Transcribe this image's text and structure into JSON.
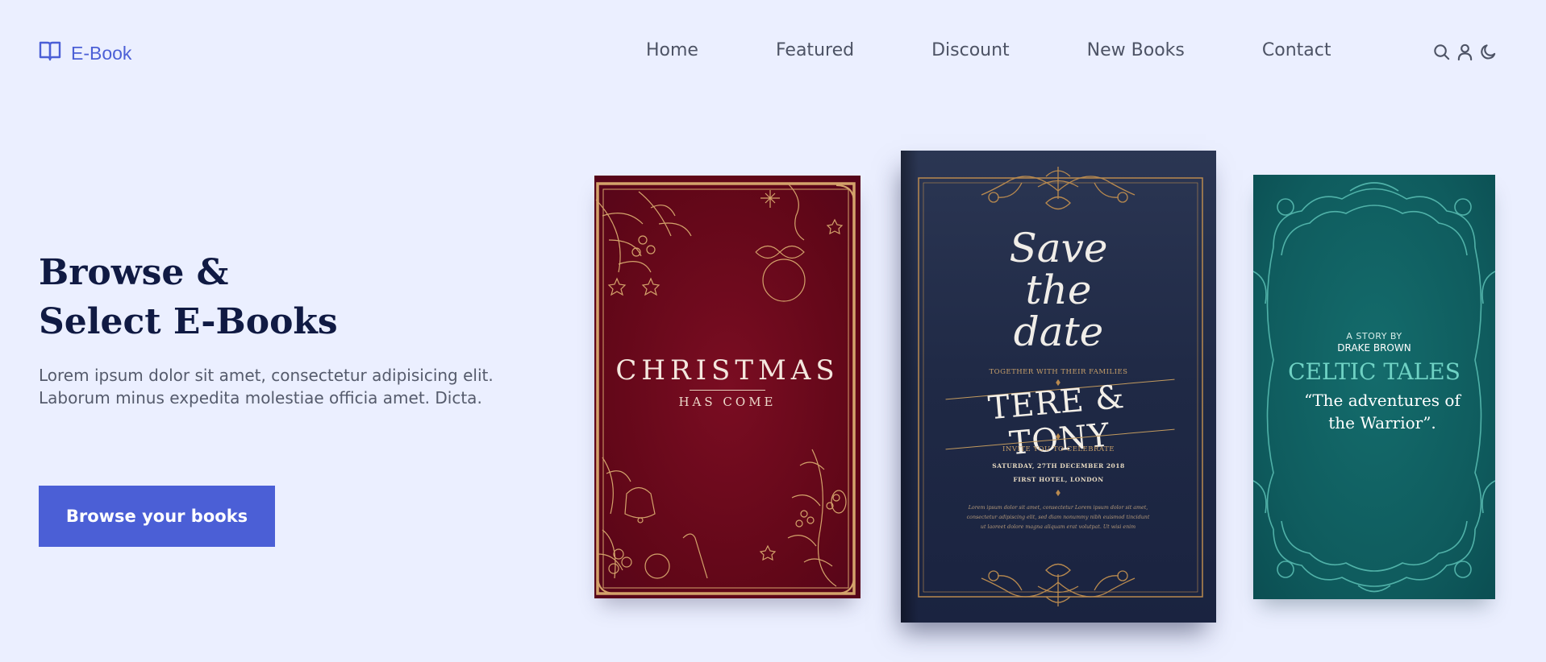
{
  "header": {
    "logo_text": "E-Book",
    "logo_icon": "book-open-icon",
    "nav": [
      {
        "label": "Home"
      },
      {
        "label": "Featured"
      },
      {
        "label": "Discount"
      },
      {
        "label": "New Books"
      },
      {
        "label": "Contact"
      }
    ],
    "icons": [
      "search-icon",
      "user-icon",
      "moon-icon"
    ]
  },
  "hero": {
    "title_line1": "Browse &",
    "title_line2": "Select E-Books",
    "desc_line1": "Lorem ipsum dolor sit amet, consectetur adipisicing elit.",
    "desc_line2": "Laborum minus expedita molestiae officia amet. Dicta.",
    "cta_label": "Browse your books"
  },
  "books": {
    "christmas": {
      "title": "CHRISTMAS",
      "subtitle": "HAS COME"
    },
    "save_date": {
      "script_line1": "Save",
      "script_line2": "the",
      "script_line3": "date",
      "together": "TOGETHER WITH THEIR FAMILIES",
      "names": "TERE & TONY",
      "invite": "INVITE YOU TO CELEBRATE",
      "date": "SATURDAY, 27TH DECEMBER 2018",
      "venue": "FIRST HOTEL, LONDON",
      "lorem": "Lorem ipsum dolor sit amet, consectetur Lorem ipsum dolor sit amet, consectetur adipiscing elit, sed diam nonummy nibh euismod tincidunt ut laoreet dolore magna aliquam erat volutpat. Ut wisi enim"
    },
    "celtic": {
      "story_by": "A STORY BY",
      "author": "DRAKE BROWN",
      "title": "CELTIC TALES",
      "quote_line1": "“The adventures of",
      "quote_line2": "the Warrior”."
    }
  },
  "colors": {
    "background": "#ebefff",
    "accent": "#4b5fd6",
    "heading": "#101a43"
  }
}
